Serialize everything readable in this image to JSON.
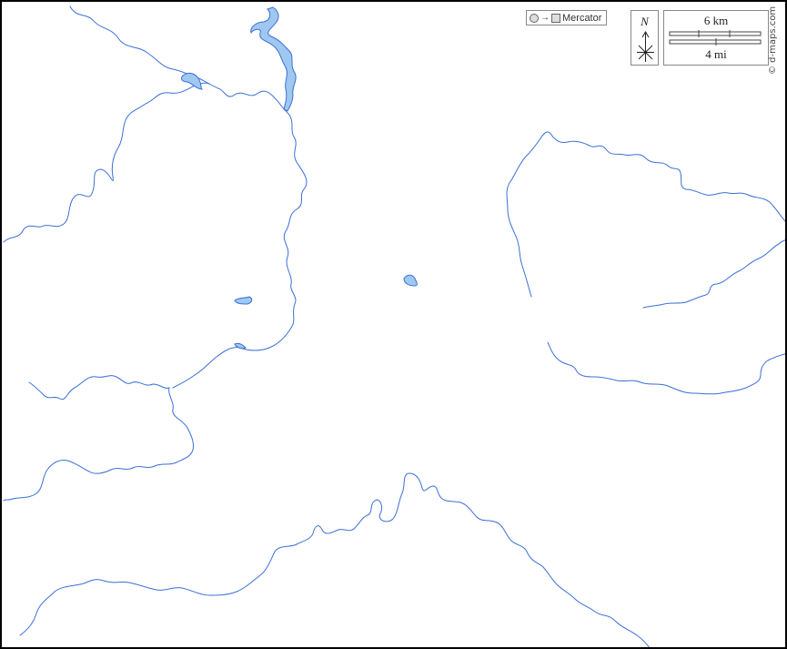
{
  "map": {
    "projection": "Mercator",
    "north_label": "N",
    "scale": {
      "km_label": "6 km",
      "mi_label": "4 mi"
    },
    "credit": "© d-maps.com",
    "colors": {
      "water_fill": "#9ec8f0",
      "river_stroke": "#3a6fd6",
      "background": "#ffffff",
      "border": "#000000"
    },
    "icons": {
      "projection": [
        "circle-icon",
        "arrow-right-icon",
        "square-icon"
      ],
      "north": "compass-rose-icon"
    }
  }
}
